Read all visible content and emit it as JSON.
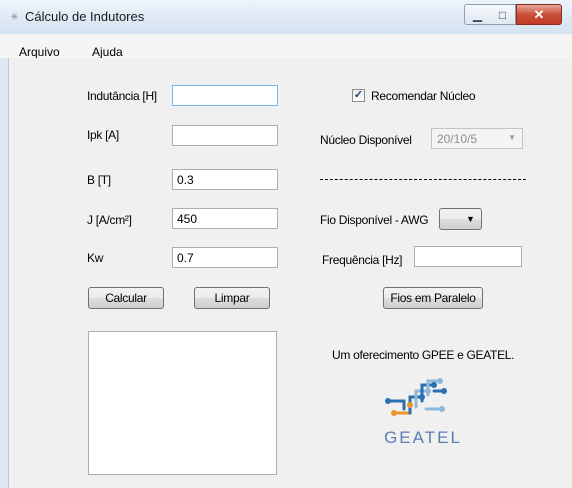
{
  "window": {
    "title": "Cálculo de Indutores",
    "app_icon": "app-icon",
    "minimize_icon": "minimize-icon",
    "maximize_icon": "maximize-icon",
    "close_icon": "close-icon"
  },
  "menu": {
    "items": [
      {
        "label": "Arquivo"
      },
      {
        "label": "Ajuda"
      }
    ]
  },
  "left": {
    "fields": [
      {
        "label": "Indutância [H]",
        "value": ""
      },
      {
        "label": "Ipk [A]",
        "value": ""
      },
      {
        "label": "B [T]",
        "value": "0.3"
      },
      {
        "label": "J [A/cm²]",
        "value": "450"
      },
      {
        "label": "Kw",
        "value": "0.7"
      }
    ],
    "calcular_label": "Calcular",
    "limpar_label": "Limpar",
    "output_text": ""
  },
  "right": {
    "recomendar_label": "Recomendar Núcleo",
    "recomendar_checked": true,
    "nucleo_label": "Núcleo Disponível",
    "nucleo_value": "20/10/5",
    "fio_label": "Fio Disponível - AWG",
    "fio_value": "",
    "freq_label": "Frequência [Hz]",
    "freq_value": "",
    "fios_paralelo_label": "Fios em Paralelo",
    "credit": "Um oferecimento GPEE e GEATEL.",
    "logo_text": "GEATEL"
  },
  "colors": {
    "logo_blue": "#2a6fb0",
    "logo_orange": "#e8962b",
    "logo_text": "#5a7fb3"
  }
}
